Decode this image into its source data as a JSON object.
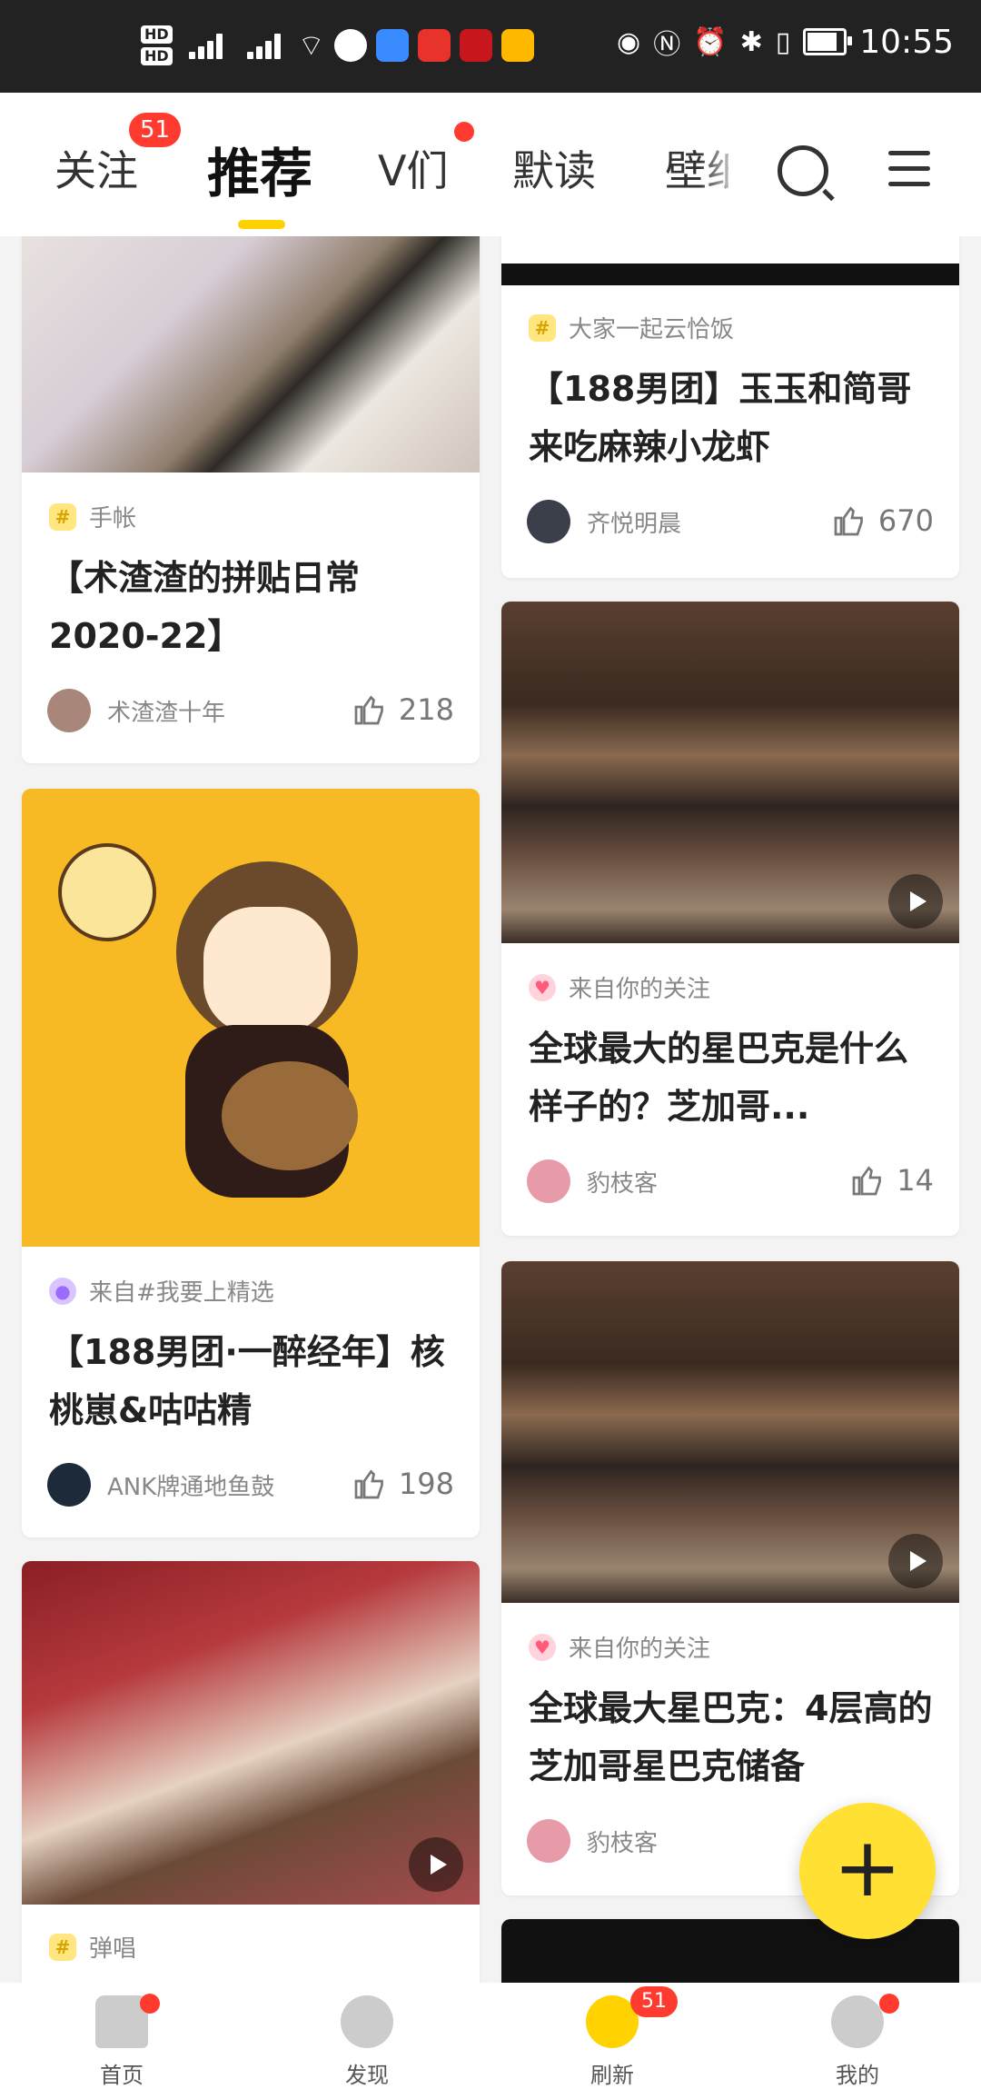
{
  "status_bar": {
    "time": "10:55",
    "hd1": "HD",
    "hd2": "HD"
  },
  "nav": {
    "tabs": [
      "关注",
      "推荐",
      "V们",
      "默读",
      "壁纸"
    ],
    "follow_badge": "51"
  },
  "cards_left": [
    {
      "tag": "手帐",
      "title": "【术渣渣的拼贴日常2020-22】",
      "author": "术渣渣十年",
      "likes": "218"
    },
    {
      "tag": "来自#我要上精选",
      "title": "【188男团·一醉经年】核桃崽&咕咕精",
      "author": "ANK牌通地鱼鼓",
      "likes": "198"
    },
    {
      "tag": "弹唱"
    }
  ],
  "cards_right": [
    {
      "tag": "大家一起云恰饭",
      "title": "【188男团】玉玉和简哥来吃麻辣小龙虾",
      "author": "齐悦明晨",
      "likes": "670"
    },
    {
      "tag": "来自你的关注",
      "title": "全球最大的星巴克是什么样子的？芝加哥...",
      "author": "豹枝客",
      "likes": "14"
    },
    {
      "tag": "来自你的关注",
      "title": "全球最大星巴克：4层高的芝加哥星巴克储备",
      "author": "豹枝客"
    }
  ],
  "fab_label": "+",
  "bottom_nav": [
    {
      "label": "首页"
    },
    {
      "label": "发现"
    },
    {
      "label": "刷新",
      "badge": "51"
    },
    {
      "label": "我的"
    }
  ],
  "colors": {
    "accent": "#ffd200",
    "badge": "#ff3b30",
    "fab": "#ffe033"
  }
}
